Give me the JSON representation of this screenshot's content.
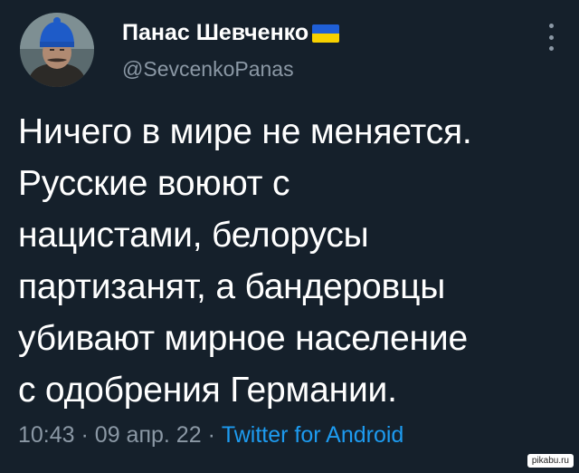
{
  "tweet": {
    "author": {
      "display_name": "Панас Шевченко",
      "handle": "@SevcenkoPanas",
      "flag_colors": {
        "top": "#1f5fd6",
        "bottom": "#f7d100"
      }
    },
    "text": "Ничего в мире не меняется.\nРусские воюют с\nнацистами, белорусы\nпартизанят, а бандеровцы\nубивают мирное население\nс одобрения Германии.",
    "time": "10:43",
    "separator": "·",
    "date": "09 апр. 22",
    "source": "Twitter for Android"
  },
  "icons": {
    "more": "more-vertical-icon",
    "avatar": "avatar"
  },
  "watermark": "pikabu.ru",
  "colors": {
    "background": "#15202b",
    "text": "#ffffff",
    "secondary": "#8b98a5",
    "link": "#1d9bf0"
  }
}
